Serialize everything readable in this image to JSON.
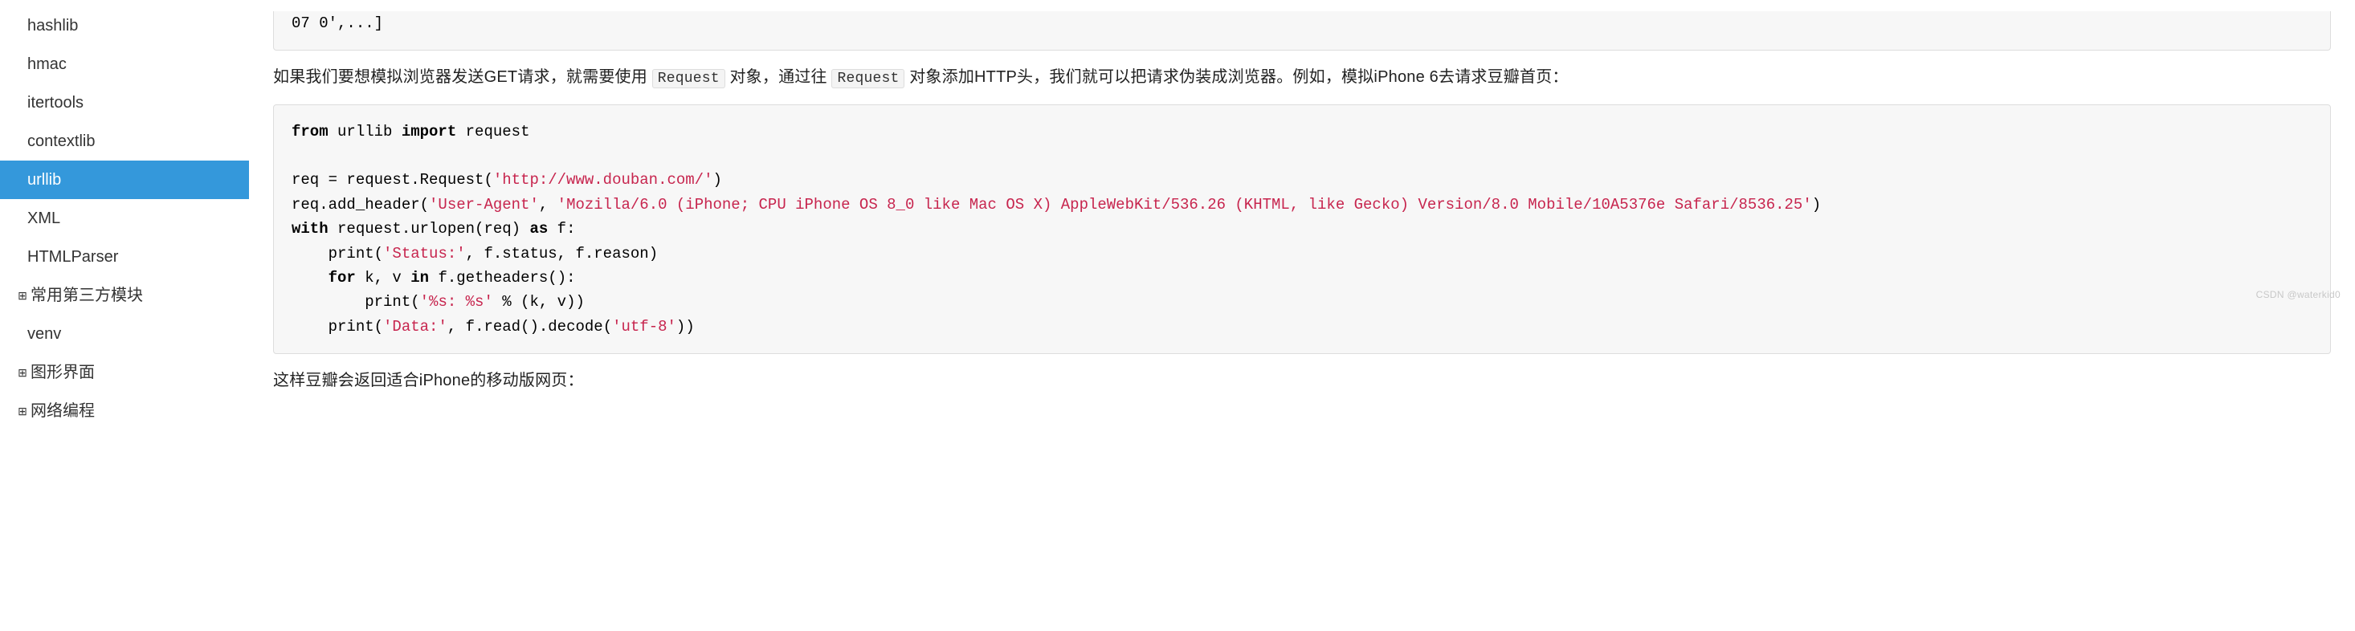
{
  "sidebar": {
    "items": [
      {
        "label": "hashlib",
        "level": 2,
        "active": false
      },
      {
        "label": "hmac",
        "level": 2,
        "active": false
      },
      {
        "label": "itertools",
        "level": 2,
        "active": false
      },
      {
        "label": "contextlib",
        "level": 2,
        "active": false
      },
      {
        "label": "urllib",
        "level": 2,
        "active": true
      },
      {
        "label": "XML",
        "level": 2,
        "active": false
      },
      {
        "label": "HTMLParser",
        "level": 2,
        "active": false
      },
      {
        "label": "常用第三方模块",
        "level": 1,
        "active": false,
        "expandable": true
      },
      {
        "label": "venv",
        "level": 2,
        "active": false
      },
      {
        "label": "图形界面",
        "level": 1,
        "active": false,
        "expandable": true
      },
      {
        "label": "网络编程",
        "level": 1,
        "active": false,
        "expandable": true
      }
    ]
  },
  "content": {
    "codeblock0_trail": "07 0',...]",
    "para1_pre": "如果我们要想模拟浏览器发送GET请求，就需要使用",
    "para1_code1": "Request",
    "para1_mid": "对象，通过往",
    "para1_code2": "Request",
    "para1_post": "对象添加HTTP头，我们就可以把请求伪装成浏览器。例如，模拟iPhone 6去请求豆瓣首页：",
    "code": {
      "kw_from": "from",
      "mod": " urllib ",
      "kw_import": "import",
      "imp": " request",
      "line3a": "req = request.Request(",
      "str_url": "'http://www.douban.com/'",
      "line3b": ")",
      "line4a": "req.add_header(",
      "str_ua_key": "'User-Agent'",
      "sep": ", ",
      "str_ua_val": "'Mozilla/6.0 (iPhone; CPU iPhone OS 8_0 like Mac OS X) AppleWebKit/536.26 (KHTML, like Gecko) Version/8.0 Mobile/10A5376e Safari/8536.25'",
      "line4b": ")",
      "kw_with": "with",
      "line5a": " request.urlopen(req) ",
      "kw_as": "as",
      "line5b": " f:",
      "line6a": "    print(",
      "str_status": "'Status:'",
      "line6b": ", f.status, f.reason)",
      "line7a": "    ",
      "kw_for": "for",
      "line7b": " k, v ",
      "kw_in": "in",
      "line7c": " f.getheaders():",
      "line8a": "        print(",
      "str_fmt": "'%s: %s'",
      "line8b": " % (k, v))",
      "line9a": "    print(",
      "str_data": "'Data:'",
      "line9b": ", f.read().decode(",
      "str_utf8": "'utf-8'",
      "line9c": "))"
    },
    "para2": "这样豆瓣会返回适合iPhone的移动版网页："
  },
  "watermark": "CSDN @waterkid0"
}
